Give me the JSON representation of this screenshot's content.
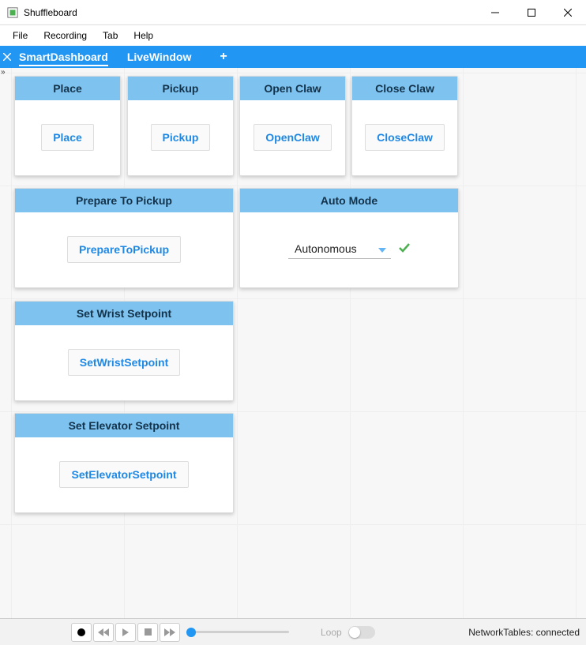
{
  "window": {
    "title": "Shuffleboard"
  },
  "menu": {
    "file": "File",
    "recording": "Recording",
    "tab": "Tab",
    "help": "Help"
  },
  "tabs": {
    "items": [
      {
        "label": "SmartDashboard",
        "active": true
      },
      {
        "label": "LiveWindow",
        "active": false
      }
    ]
  },
  "widgets": {
    "place": {
      "title": "Place",
      "button": "Place"
    },
    "pickup": {
      "title": "Pickup",
      "button": "Pickup"
    },
    "openclaw": {
      "title": "Open Claw",
      "button": "OpenClaw"
    },
    "closeclaw": {
      "title": "Close Claw",
      "button": "CloseClaw"
    },
    "prepare": {
      "title": "Prepare To Pickup",
      "button": "PrepareToPickup"
    },
    "automode": {
      "title": "Auto Mode",
      "selected": "Autonomous"
    },
    "wrist": {
      "title": "Set Wrist Setpoint",
      "button": "SetWristSetpoint"
    },
    "elevator": {
      "title": "Set Elevator Setpoint",
      "button": "SetElevatorSetpoint"
    }
  },
  "playback": {
    "loop_label": "Loop"
  },
  "status": {
    "text": "NetworkTables: connected"
  }
}
